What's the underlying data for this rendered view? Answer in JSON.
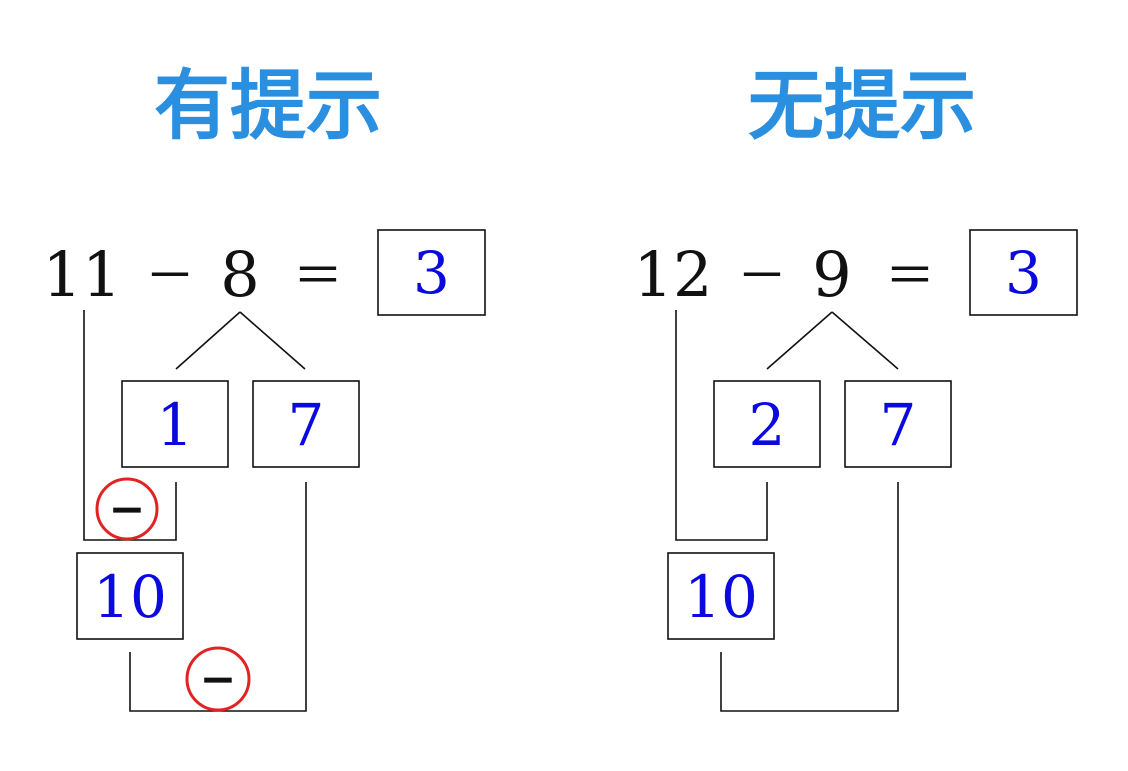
{
  "colors": {
    "title": "#2b8fe0",
    "answer": "#0a0adf",
    "line": "#111111",
    "circle": "#e02424"
  },
  "panels": [
    {
      "title": "有提示",
      "minuend": "11",
      "operator": "－",
      "subtrahend": "8",
      "equals": "＝",
      "answer": "3",
      "split_left": "1",
      "split_right": "7",
      "ten": "10",
      "show_hints": true,
      "hint_symbol": "−"
    },
    {
      "title": "无提示",
      "minuend": "12",
      "operator": "－",
      "subtrahend": "9",
      "equals": "＝",
      "answer": "3",
      "split_left": "2",
      "split_right": "7",
      "ten": "10",
      "show_hints": false
    }
  ]
}
